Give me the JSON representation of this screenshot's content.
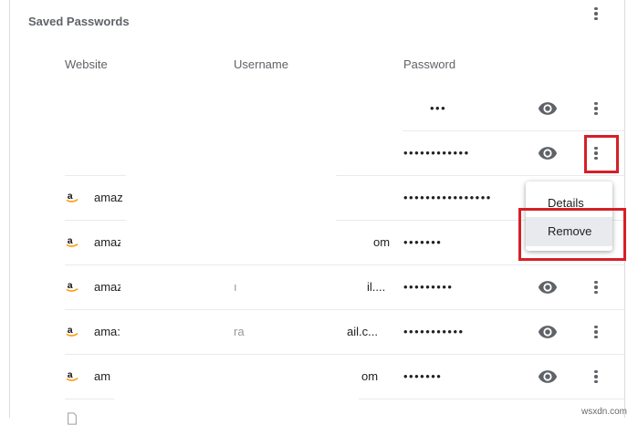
{
  "section": {
    "title": "Saved Passwords",
    "more_icon": "more-vert-icon"
  },
  "columns": {
    "website": "Website",
    "username": "Username",
    "password": "Password"
  },
  "rows": [
    {
      "website": "",
      "username": "",
      "password": "•••",
      "site_icon": "",
      "actions": [
        "eye-icon",
        "more-vert-icon"
      ]
    },
    {
      "website": "",
      "username": "",
      "password": "••••••••••••",
      "site_icon": "",
      "actions": [
        "eye-icon",
        "more-vert-icon"
      ],
      "menu_open": true
    },
    {
      "website": "amaz",
      "username": "",
      "password": "••••••••••••••••",
      "site_icon": "amazon-logo-icon"
    },
    {
      "website": "amaz",
      "username": "om",
      "password": "•••••••",
      "site_icon": "amazon-logo-icon"
    },
    {
      "website": "amaz",
      "username": "il....",
      "password": "•••••••••",
      "site_icon": "amazon-logo-icon"
    },
    {
      "website": "ama:",
      "username": "ail.c...",
      "password": "•••••••••••",
      "site_icon": "amazon-logo-icon"
    },
    {
      "website": "am",
      "username": "om",
      "password": "•••••••",
      "site_icon": "amazon-logo-icon"
    }
  ],
  "context_menu": {
    "items": [
      "Details",
      "Remove"
    ],
    "hovered": "Remove"
  },
  "highlight_color": "#d61f26",
  "watermark": "wsxdn.com"
}
